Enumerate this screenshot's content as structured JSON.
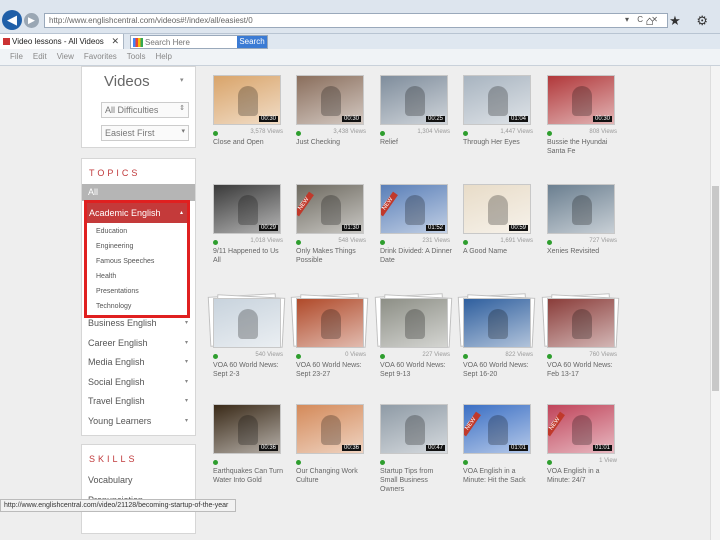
{
  "browser": {
    "address": "http://www.englishcentral.com/videos#!/index/all/easiest/0",
    "address_icons": "▾ C ✕",
    "toolbar_icons": "⌂ ★ ⚙",
    "tab_title": "Video lessons - All Videos",
    "tab_close": "✕",
    "search_placeholder": "Search Here",
    "search_button": "Search",
    "menu": [
      "File",
      "Edit",
      "View",
      "Favorites",
      "Tools",
      "Help"
    ],
    "status_url": "http://www.englishcentral.com/video/21128/becoming-startup-of-the-year"
  },
  "sidebar": {
    "heading": "Videos",
    "heading_arrow": "▾",
    "difficulty": "All Difficulties",
    "sort": "Easiest First",
    "topics_heading": "TOPICS",
    "all_label": "All",
    "academic": {
      "label": "Academic English",
      "arrow": "▴",
      "subtopics": [
        "Education",
        "Engineering",
        "Famous Speeches",
        "Health",
        "Presentations",
        "Technology"
      ]
    },
    "topic_arrow": "▾",
    "topics": [
      "Business English",
      "Career English",
      "Media English",
      "Social English",
      "Travel English",
      "Young Learners"
    ],
    "skills_heading": "SKILLS",
    "skills": [
      "Vocabulary",
      "Pronunciation"
    ]
  },
  "videos": [
    {
      "title": "Close and Open",
      "views": "3,578 Views",
      "duration": "00:30",
      "is_new": false,
      "stacked": false,
      "color": "#d9a46a"
    },
    {
      "title": "Just Checking",
      "views": "3,438 Views",
      "duration": "00:30",
      "is_new": false,
      "stacked": false,
      "color": "#8a6e5c"
    },
    {
      "title": "Relief",
      "views": "1,304 Views",
      "duration": "00:25",
      "is_new": false,
      "stacked": false,
      "color": "#7f8d9c"
    },
    {
      "title": "Through Her Eyes",
      "views": "1,447 Views",
      "duration": "01:04",
      "is_new": false,
      "stacked": false,
      "color": "#a8b4c0"
    },
    {
      "title": "Bussie the Hyundai Santa Fe",
      "views": "808 Views",
      "duration": "00:30",
      "is_new": false,
      "stacked": false,
      "color": "#b1383a"
    },
    {
      "title": "9/11 Happened to Us All",
      "views": "1,018 Views",
      "duration": "00:29",
      "is_new": false,
      "stacked": false,
      "color": "#3a3a3a"
    },
    {
      "title": "Only Makes Things Possible",
      "views": "548 Views",
      "duration": "01:30",
      "is_new": true,
      "stacked": false,
      "color": "#6e6a60"
    },
    {
      "title": "Drink Divided: A Dinner Date",
      "views": "231 Views",
      "duration": "01:52",
      "is_new": true,
      "stacked": false,
      "color": "#5a7fb8"
    },
    {
      "title": "A Good Name",
      "views": "1,691 Views",
      "duration": "00:59",
      "is_new": false,
      "stacked": false,
      "color": "#e8dcc8"
    },
    {
      "title": "Xenies Revisited",
      "views": "727 Views",
      "duration": "",
      "is_new": false,
      "stacked": false,
      "color": "#6b7f90"
    },
    {
      "title": "VOA 60 World News: Sept 2-3",
      "views": "540 Views",
      "duration": "",
      "is_new": false,
      "stacked": true,
      "color": "#c8d3dd"
    },
    {
      "title": "VOA 60 World News: Sept 23-27",
      "views": "0 Views",
      "duration": "",
      "is_new": false,
      "stacked": true,
      "color": "#b04a2a"
    },
    {
      "title": "VOA 60 World News: Sept 9-13",
      "views": "227 Views",
      "duration": "",
      "is_new": false,
      "stacked": true,
      "color": "#8d8f86"
    },
    {
      "title": "VOA 60 World News: Sept 16-20",
      "views": "822 Views",
      "duration": "",
      "is_new": false,
      "stacked": true,
      "color": "#2f5f9e"
    },
    {
      "title": "VOA 60 World News: Feb 13-17",
      "views": "760 Views",
      "duration": "",
      "is_new": false,
      "stacked": true,
      "color": "#8a3d3a"
    },
    {
      "title": "Earthquakes Can Turn Water Into Gold",
      "views": "",
      "duration": "00:36",
      "is_new": false,
      "stacked": false,
      "color": "#3a2a18"
    },
    {
      "title": "Our Changing Work Culture",
      "views": "",
      "duration": "00:36",
      "is_new": false,
      "stacked": false,
      "color": "#d48a5a"
    },
    {
      "title": "Startup Tips from Small Business Owners",
      "views": "",
      "duration": "00:47",
      "is_new": false,
      "stacked": false,
      "color": "#8f9ba6"
    },
    {
      "title": "VOA English in a Minute: Hit the Sack",
      "views": "",
      "duration": "01:01",
      "is_new": true,
      "stacked": false,
      "color": "#3b6fc4"
    },
    {
      "title": "VOA English in a Minute: 24/7",
      "views": "1 View",
      "duration": "01:01",
      "is_new": true,
      "stacked": false,
      "color": "#c0445a"
    }
  ],
  "labels": {
    "new_badge": "NEW"
  }
}
